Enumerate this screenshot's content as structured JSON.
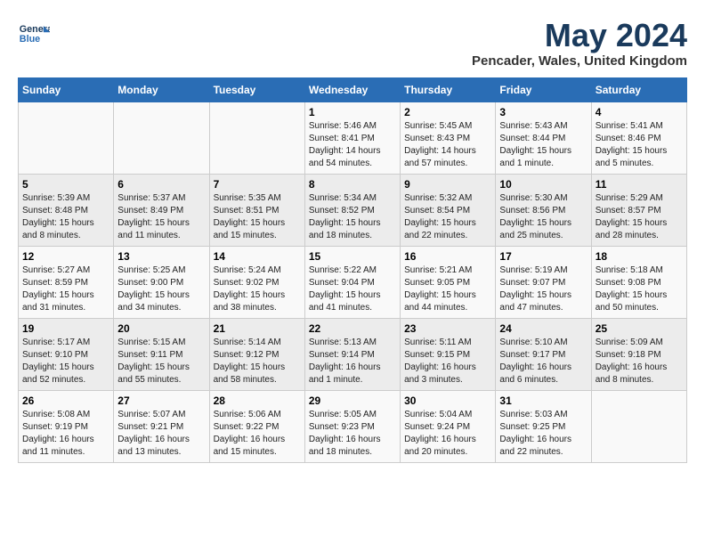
{
  "header": {
    "logo_line1": "General",
    "logo_line2": "Blue",
    "month_title": "May 2024",
    "location": "Pencader, Wales, United Kingdom"
  },
  "days_of_week": [
    "Sunday",
    "Monday",
    "Tuesday",
    "Wednesday",
    "Thursday",
    "Friday",
    "Saturday"
  ],
  "weeks": [
    [
      {
        "day": "",
        "info": ""
      },
      {
        "day": "",
        "info": ""
      },
      {
        "day": "",
        "info": ""
      },
      {
        "day": "1",
        "info": "Sunrise: 5:46 AM\nSunset: 8:41 PM\nDaylight: 14 hours\nand 54 minutes."
      },
      {
        "day": "2",
        "info": "Sunrise: 5:45 AM\nSunset: 8:43 PM\nDaylight: 14 hours\nand 57 minutes."
      },
      {
        "day": "3",
        "info": "Sunrise: 5:43 AM\nSunset: 8:44 PM\nDaylight: 15 hours\nand 1 minute."
      },
      {
        "day": "4",
        "info": "Sunrise: 5:41 AM\nSunset: 8:46 PM\nDaylight: 15 hours\nand 5 minutes."
      }
    ],
    [
      {
        "day": "5",
        "info": "Sunrise: 5:39 AM\nSunset: 8:48 PM\nDaylight: 15 hours\nand 8 minutes."
      },
      {
        "day": "6",
        "info": "Sunrise: 5:37 AM\nSunset: 8:49 PM\nDaylight: 15 hours\nand 11 minutes."
      },
      {
        "day": "7",
        "info": "Sunrise: 5:35 AM\nSunset: 8:51 PM\nDaylight: 15 hours\nand 15 minutes."
      },
      {
        "day": "8",
        "info": "Sunrise: 5:34 AM\nSunset: 8:52 PM\nDaylight: 15 hours\nand 18 minutes."
      },
      {
        "day": "9",
        "info": "Sunrise: 5:32 AM\nSunset: 8:54 PM\nDaylight: 15 hours\nand 22 minutes."
      },
      {
        "day": "10",
        "info": "Sunrise: 5:30 AM\nSunset: 8:56 PM\nDaylight: 15 hours\nand 25 minutes."
      },
      {
        "day": "11",
        "info": "Sunrise: 5:29 AM\nSunset: 8:57 PM\nDaylight: 15 hours\nand 28 minutes."
      }
    ],
    [
      {
        "day": "12",
        "info": "Sunrise: 5:27 AM\nSunset: 8:59 PM\nDaylight: 15 hours\nand 31 minutes."
      },
      {
        "day": "13",
        "info": "Sunrise: 5:25 AM\nSunset: 9:00 PM\nDaylight: 15 hours\nand 34 minutes."
      },
      {
        "day": "14",
        "info": "Sunrise: 5:24 AM\nSunset: 9:02 PM\nDaylight: 15 hours\nand 38 minutes."
      },
      {
        "day": "15",
        "info": "Sunrise: 5:22 AM\nSunset: 9:04 PM\nDaylight: 15 hours\nand 41 minutes."
      },
      {
        "day": "16",
        "info": "Sunrise: 5:21 AM\nSunset: 9:05 PM\nDaylight: 15 hours\nand 44 minutes."
      },
      {
        "day": "17",
        "info": "Sunrise: 5:19 AM\nSunset: 9:07 PM\nDaylight: 15 hours\nand 47 minutes."
      },
      {
        "day": "18",
        "info": "Sunrise: 5:18 AM\nSunset: 9:08 PM\nDaylight: 15 hours\nand 50 minutes."
      }
    ],
    [
      {
        "day": "19",
        "info": "Sunrise: 5:17 AM\nSunset: 9:10 PM\nDaylight: 15 hours\nand 52 minutes."
      },
      {
        "day": "20",
        "info": "Sunrise: 5:15 AM\nSunset: 9:11 PM\nDaylight: 15 hours\nand 55 minutes."
      },
      {
        "day": "21",
        "info": "Sunrise: 5:14 AM\nSunset: 9:12 PM\nDaylight: 15 hours\nand 58 minutes."
      },
      {
        "day": "22",
        "info": "Sunrise: 5:13 AM\nSunset: 9:14 PM\nDaylight: 16 hours\nand 1 minute."
      },
      {
        "day": "23",
        "info": "Sunrise: 5:11 AM\nSunset: 9:15 PM\nDaylight: 16 hours\nand 3 minutes."
      },
      {
        "day": "24",
        "info": "Sunrise: 5:10 AM\nSunset: 9:17 PM\nDaylight: 16 hours\nand 6 minutes."
      },
      {
        "day": "25",
        "info": "Sunrise: 5:09 AM\nSunset: 9:18 PM\nDaylight: 16 hours\nand 8 minutes."
      }
    ],
    [
      {
        "day": "26",
        "info": "Sunrise: 5:08 AM\nSunset: 9:19 PM\nDaylight: 16 hours\nand 11 minutes."
      },
      {
        "day": "27",
        "info": "Sunrise: 5:07 AM\nSunset: 9:21 PM\nDaylight: 16 hours\nand 13 minutes."
      },
      {
        "day": "28",
        "info": "Sunrise: 5:06 AM\nSunset: 9:22 PM\nDaylight: 16 hours\nand 15 minutes."
      },
      {
        "day": "29",
        "info": "Sunrise: 5:05 AM\nSunset: 9:23 PM\nDaylight: 16 hours\nand 18 minutes."
      },
      {
        "day": "30",
        "info": "Sunrise: 5:04 AM\nSunset: 9:24 PM\nDaylight: 16 hours\nand 20 minutes."
      },
      {
        "day": "31",
        "info": "Sunrise: 5:03 AM\nSunset: 9:25 PM\nDaylight: 16 hours\nand 22 minutes."
      },
      {
        "day": "",
        "info": ""
      }
    ]
  ]
}
